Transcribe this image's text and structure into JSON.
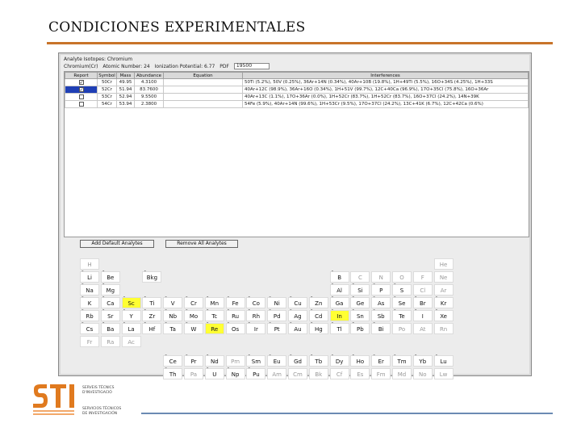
{
  "slide": {
    "title": "CONDICIONES EXPERIMENTALES"
  },
  "window": {
    "info": {
      "label1": "Analyte Isotopes: Chromium",
      "label2": "Chromium(Cr)",
      "atomic": "Atomic Number: 24",
      "ionization": "Ionization Potential: 6.77",
      "pdf_label": "PDF",
      "pdf_value": "19500"
    },
    "table": {
      "headers": [
        "Report",
        "Symbol",
        "Mass",
        "Abundance",
        "Equation",
        "Interferences"
      ],
      "rows": [
        {
          "selected": false,
          "checked": true,
          "symbol": "50Cr",
          "mass": "49.95",
          "abundance": "4.3100",
          "equation": "",
          "interf": "50Ti (5.2%), 50V (0.25%), 36Ar+14N (0.34%), 40Ar+10B (19.8%), 1H+49Ti (5.5%), 16O+34S (4.25%), 1H+33S"
        },
        {
          "selected": true,
          "checked": true,
          "symbol": "52Cr",
          "mass": "51.94",
          "abundance": "83.7600",
          "equation": "",
          "interf": "40Ar+12C (98.9%), 36Ar+16O (0.34%), 1H+51V (99.7%), 12C+40Ca (96.9%), 17O+35Cl (75.8%), 16O+36Ar"
        },
        {
          "selected": false,
          "checked": false,
          "symbol": "53Cr",
          "mass": "52.94",
          "abundance": "9.5500",
          "equation": "",
          "interf": "40Ar+13C (1.1%), 17O+36Ar (0.0%), 1H+52Cr (83.7%), 1H+52Cr (83.7%), 16O+37Cl (24.2%), 14N+39K"
        },
        {
          "selected": false,
          "checked": false,
          "symbol": "54Cr",
          "mass": "53.94",
          "abundance": "2.3800",
          "equation": "",
          "interf": "54Fe (5.9%), 40Ar+14N (99.6%), 1H+53Cr (9.5%), 17O+37Cl (24.2%), 13C+41K (6.7%), 12C+42Ca (0.6%)"
        }
      ]
    },
    "buttons": {
      "add_default": "Add Default Analytes",
      "remove_all": "Remove All Analytes"
    },
    "elements": [
      {
        "s": "H",
        "r": 0,
        "c": 0,
        "t": "dim"
      },
      {
        "s": "He",
        "r": 0,
        "c": 17,
        "t": "dim"
      },
      {
        "s": "Li",
        "r": 1,
        "c": 0
      },
      {
        "s": "Be",
        "r": 1,
        "c": 1
      },
      {
        "s": "Bkg",
        "r": 1,
        "c": 3
      },
      {
        "s": "B",
        "r": 1,
        "c": 12
      },
      {
        "s": "C",
        "r": 1,
        "c": 13,
        "t": "dim"
      },
      {
        "s": "N",
        "r": 1,
        "c": 14,
        "t": "dim"
      },
      {
        "s": "O",
        "r": 1,
        "c": 15,
        "t": "dim"
      },
      {
        "s": "F",
        "r": 1,
        "c": 16,
        "t": "dim"
      },
      {
        "s": "Ne",
        "r": 1,
        "c": 17,
        "t": "dim"
      },
      {
        "s": "Na",
        "r": 2,
        "c": 0
      },
      {
        "s": "Mg",
        "r": 2,
        "c": 1
      },
      {
        "s": "Al",
        "r": 2,
        "c": 12
      },
      {
        "s": "Si",
        "r": 2,
        "c": 13
      },
      {
        "s": "P",
        "r": 2,
        "c": 14
      },
      {
        "s": "S",
        "r": 2,
        "c": 15
      },
      {
        "s": "Cl",
        "r": 2,
        "c": 16,
        "t": "dim"
      },
      {
        "s": "Ar",
        "r": 2,
        "c": 17,
        "t": "dim"
      },
      {
        "s": "K",
        "r": 3,
        "c": 0
      },
      {
        "s": "Ca",
        "r": 3,
        "c": 1
      },
      {
        "s": "Sc",
        "r": 3,
        "c": 2,
        "t": "hl"
      },
      {
        "s": "Ti",
        "r": 3,
        "c": 3
      },
      {
        "s": "V",
        "r": 3,
        "c": 4
      },
      {
        "s": "Cr",
        "r": 3,
        "c": 5
      },
      {
        "s": "Mn",
        "r": 3,
        "c": 6
      },
      {
        "s": "Fe",
        "r": 3,
        "c": 7
      },
      {
        "s": "Co",
        "r": 3,
        "c": 8
      },
      {
        "s": "Ni",
        "r": 3,
        "c": 9
      },
      {
        "s": "Cu",
        "r": 3,
        "c": 10
      },
      {
        "s": "Zn",
        "r": 3,
        "c": 11
      },
      {
        "s": "Ga",
        "r": 3,
        "c": 12
      },
      {
        "s": "Ge",
        "r": 3,
        "c": 13
      },
      {
        "s": "As",
        "r": 3,
        "c": 14
      },
      {
        "s": "Se",
        "r": 3,
        "c": 15
      },
      {
        "s": "Br",
        "r": 3,
        "c": 16
      },
      {
        "s": "Kr",
        "r": 3,
        "c": 17
      },
      {
        "s": "Rb",
        "r": 4,
        "c": 0
      },
      {
        "s": "Sr",
        "r": 4,
        "c": 1
      },
      {
        "s": "Y",
        "r": 4,
        "c": 2
      },
      {
        "s": "Zr",
        "r": 4,
        "c": 3
      },
      {
        "s": "Nb",
        "r": 4,
        "c": 4
      },
      {
        "s": "Mo",
        "r": 4,
        "c": 5
      },
      {
        "s": "Tc",
        "r": 4,
        "c": 6
      },
      {
        "s": "Ru",
        "r": 4,
        "c": 7
      },
      {
        "s": "Rh",
        "r": 4,
        "c": 8
      },
      {
        "s": "Pd",
        "r": 4,
        "c": 9
      },
      {
        "s": "Ag",
        "r": 4,
        "c": 10
      },
      {
        "s": "Cd",
        "r": 4,
        "c": 11
      },
      {
        "s": "In",
        "r": 4,
        "c": 12,
        "t": "hl"
      },
      {
        "s": "Sn",
        "r": 4,
        "c": 13
      },
      {
        "s": "Sb",
        "r": 4,
        "c": 14
      },
      {
        "s": "Te",
        "r": 4,
        "c": 15
      },
      {
        "s": "I",
        "r": 4,
        "c": 16
      },
      {
        "s": "Xe",
        "r": 4,
        "c": 17
      },
      {
        "s": "Cs",
        "r": 5,
        "c": 0
      },
      {
        "s": "Ba",
        "r": 5,
        "c": 1
      },
      {
        "s": "La",
        "r": 5,
        "c": 2
      },
      {
        "s": "Hf",
        "r": 5,
        "c": 3
      },
      {
        "s": "Ta",
        "r": 5,
        "c": 4
      },
      {
        "s": "W",
        "r": 5,
        "c": 5
      },
      {
        "s": "Re",
        "r": 5,
        "c": 6,
        "t": "hl"
      },
      {
        "s": "Os",
        "r": 5,
        "c": 7
      },
      {
        "s": "Ir",
        "r": 5,
        "c": 8
      },
      {
        "s": "Pt",
        "r": 5,
        "c": 9
      },
      {
        "s": "Au",
        "r": 5,
        "c": 10
      },
      {
        "s": "Hg",
        "r": 5,
        "c": 11
      },
      {
        "s": "Tl",
        "r": 5,
        "c": 12
      },
      {
        "s": "Pb",
        "r": 5,
        "c": 13
      },
      {
        "s": "Bi",
        "r": 5,
        "c": 14
      },
      {
        "s": "Po",
        "r": 5,
        "c": 15,
        "t": "dim"
      },
      {
        "s": "At",
        "r": 5,
        "c": 16,
        "t": "dim"
      },
      {
        "s": "Rn",
        "r": 5,
        "c": 17,
        "t": "dim"
      },
      {
        "s": "Fr",
        "r": 6,
        "c": 0,
        "t": "dim"
      },
      {
        "s": "Ra",
        "r": 6,
        "c": 1,
        "t": "dim"
      },
      {
        "s": "Ac",
        "r": 6,
        "c": 2,
        "t": "dim"
      },
      {
        "s": "Ce",
        "r": 7,
        "c": 4
      },
      {
        "s": "Pr",
        "r": 7,
        "c": 5
      },
      {
        "s": "Nd",
        "r": 7,
        "c": 6
      },
      {
        "s": "Pm",
        "r": 7,
        "c": 7,
        "t": "dim"
      },
      {
        "s": "Sm",
        "r": 7,
        "c": 8
      },
      {
        "s": "Eu",
        "r": 7,
        "c": 9
      },
      {
        "s": "Gd",
        "r": 7,
        "c": 10
      },
      {
        "s": "Tb",
        "r": 7,
        "c": 11
      },
      {
        "s": "Dy",
        "r": 7,
        "c": 12
      },
      {
        "s": "Ho",
        "r": 7,
        "c": 13
      },
      {
        "s": "Er",
        "r": 7,
        "c": 14
      },
      {
        "s": "Tm",
        "r": 7,
        "c": 15
      },
      {
        "s": "Yb",
        "r": 7,
        "c": 16
      },
      {
        "s": "Lu",
        "r": 7,
        "c": 17
      },
      {
        "s": "Th",
        "r": 8,
        "c": 4
      },
      {
        "s": "Pa",
        "r": 8,
        "c": 5,
        "t": "dim"
      },
      {
        "s": "U",
        "r": 8,
        "c": 6
      },
      {
        "s": "Np",
        "r": 8,
        "c": 7
      },
      {
        "s": "Pu",
        "r": 8,
        "c": 8
      },
      {
        "s": "Am",
        "r": 8,
        "c": 9,
        "t": "dim"
      },
      {
        "s": "Cm",
        "r": 8,
        "c": 10,
        "t": "dim"
      },
      {
        "s": "Bk",
        "r": 8,
        "c": 11,
        "t": "dim"
      },
      {
        "s": "Cf",
        "r": 8,
        "c": 12,
        "t": "dim"
      },
      {
        "s": "Es",
        "r": 8,
        "c": 13,
        "t": "dim"
      },
      {
        "s": "Fm",
        "r": 8,
        "c": 14,
        "t": "dim"
      },
      {
        "s": "Md",
        "r": 8,
        "c": 15,
        "t": "dim"
      },
      {
        "s": "No",
        "r": 8,
        "c": 16,
        "t": "dim"
      },
      {
        "s": "Lw",
        "r": 8,
        "c": 17,
        "t": "dim"
      }
    ]
  },
  "logo": {
    "text": "STI",
    "lines": [
      "SERVEIS TÈCNICS",
      "D'INVESTIGACIÓ",
      "SERVICIOS TÉCNICOS",
      "DE INVESTIGACIÓN"
    ]
  },
  "colors": {
    "accent": "#c8742a",
    "highlight": "#ffff33",
    "selected": "#1f3fb5",
    "bottom_rule": "#6b8ab3"
  }
}
